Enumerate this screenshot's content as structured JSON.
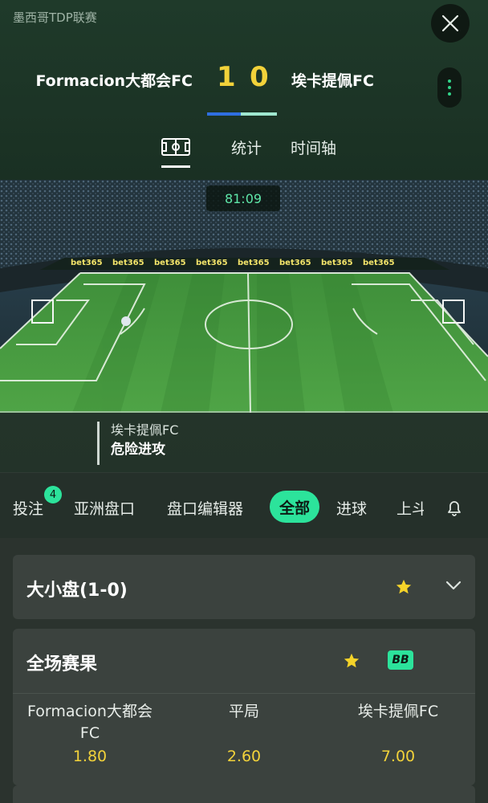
{
  "header": {
    "league": "墨西哥TDP联赛",
    "home_team": "Formacion大都会FC",
    "away_team": "埃卡提佩FC",
    "home_score": "1",
    "away_score": "0",
    "tabs": [
      {
        "label": "统计"
      },
      {
        "label": "时间轴"
      }
    ]
  },
  "pitch": {
    "timer": "81:09",
    "sponsor": "bet365",
    "event_team": "埃卡提佩FC",
    "event_text": "危险进攻"
  },
  "market_tabs": {
    "items": [
      {
        "label": "投注"
      },
      {
        "label": "亚洲盘口"
      },
      {
        "label": "盘口编辑器"
      },
      {
        "label": "全部"
      },
      {
        "label": "进球"
      },
      {
        "label": "上斗"
      }
    ],
    "bet_count": "4"
  },
  "markets": [
    {
      "title": "大小盘(1-0)"
    },
    {
      "title": "全场赛果",
      "badge": "BB",
      "outcomes": [
        {
          "name": "Formacion大都会FC",
          "odds": "1.80"
        },
        {
          "name": "平局",
          "odds": "2.60"
        },
        {
          "name": "埃卡提佩FC",
          "odds": "7.00"
        }
      ]
    }
  ],
  "colors": {
    "accent": "#2ce39b",
    "score": "#f2d23a",
    "odds": "#f2d23a",
    "home_bar": "#2f6fe0",
    "away_bar": "#9fe8cf"
  }
}
